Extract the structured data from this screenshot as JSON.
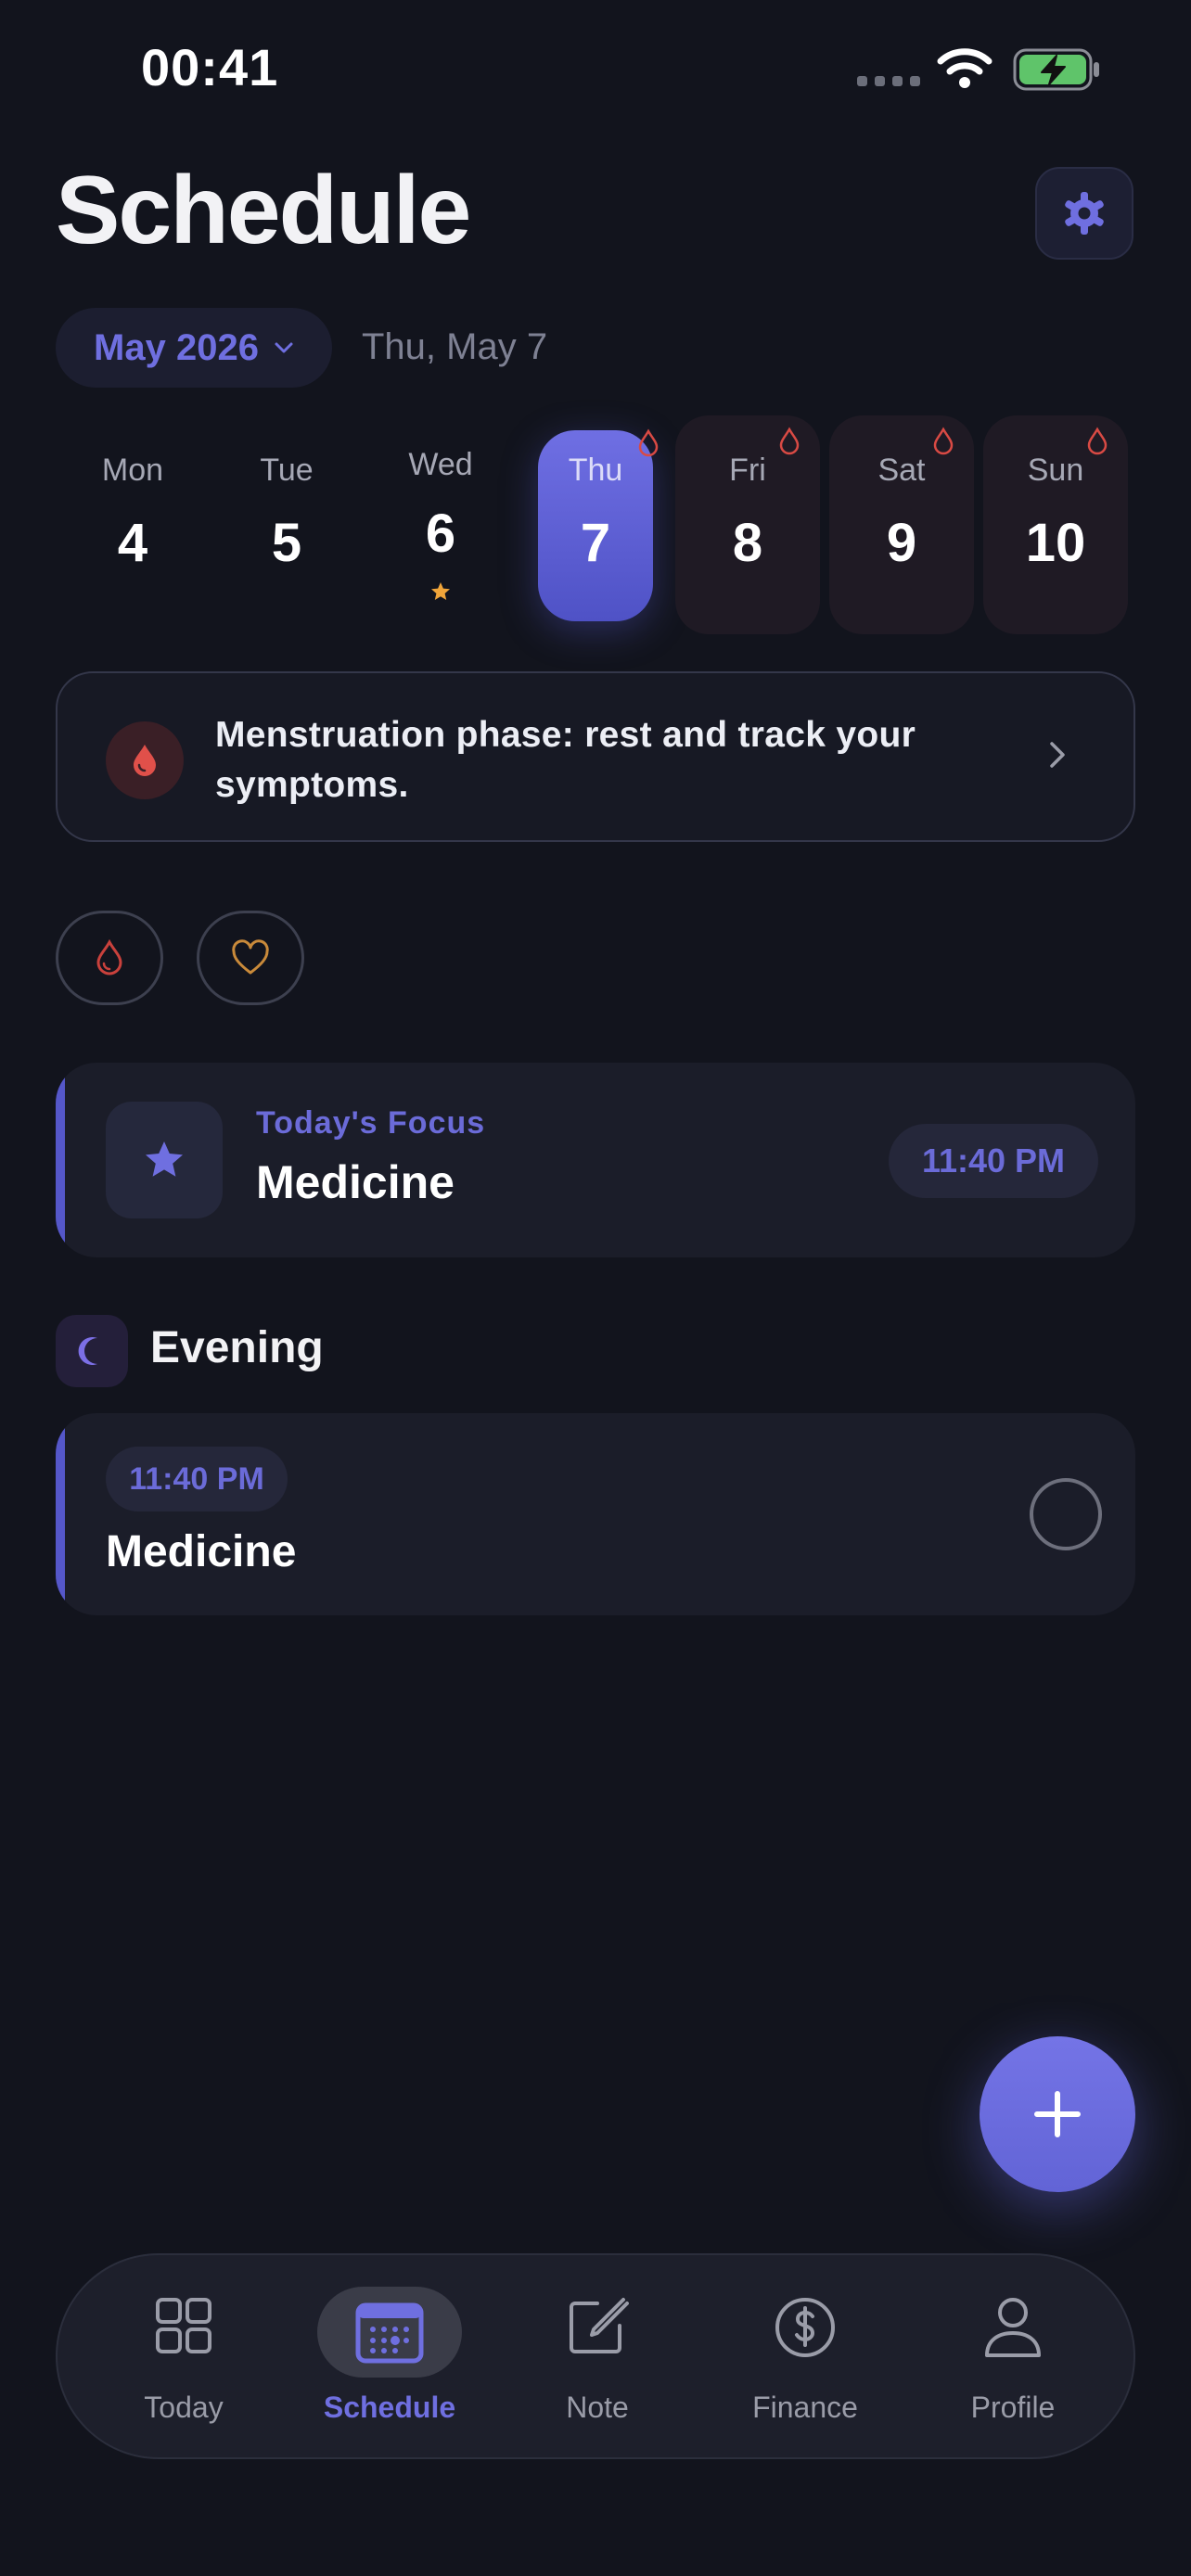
{
  "status_bar": {
    "time": "00:41"
  },
  "header": {
    "title": "Schedule"
  },
  "date_selector": {
    "month": "May 2026",
    "current_date": "Thu, May 7"
  },
  "week": [
    {
      "day": "Mon",
      "date": "4"
    },
    {
      "day": "Tue",
      "date": "5"
    },
    {
      "day": "Wed",
      "date": "6"
    },
    {
      "day": "Thu",
      "date": "7"
    },
    {
      "day": "Fri",
      "date": "8"
    },
    {
      "day": "Sat",
      "date": "9"
    },
    {
      "day": "Sun",
      "date": "10"
    }
  ],
  "phase_banner": {
    "text": "Menstruation phase: rest and track your symptoms."
  },
  "focus": {
    "kicker": "Today's Focus",
    "title": "Medicine",
    "time": "11:40 PM"
  },
  "sections": [
    {
      "title": "Evening",
      "tasks": [
        {
          "time": "11:40 PM",
          "title": "Medicine"
        }
      ]
    }
  ],
  "tabbar": {
    "items": [
      {
        "label": "Today",
        "icon": "grid-icon"
      },
      {
        "label": "Schedule",
        "icon": "calendar-icon"
      },
      {
        "label": "Note",
        "icon": "note-edit-icon"
      },
      {
        "label": "Finance",
        "icon": "dollar-icon"
      },
      {
        "label": "Profile",
        "icon": "person-icon"
      }
    ],
    "active": "Schedule"
  },
  "colors": {
    "background": "#12141d",
    "accent": "#6f6fe0",
    "period_red": "#d94a44",
    "favorite_orange": "#c98a3a",
    "star_orange": "#f0a53a"
  }
}
